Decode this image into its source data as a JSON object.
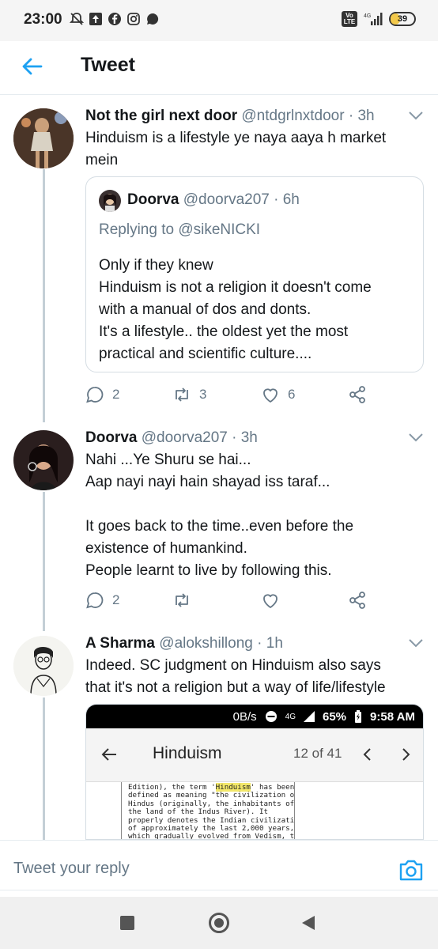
{
  "status_bar": {
    "time": "23:00",
    "network": "4G",
    "volte": "Vo LTE",
    "battery": "39",
    "battery_level_percent": 39
  },
  "header": {
    "title": "Tweet"
  },
  "tweets": [
    {
      "name": "Not the girl next door",
      "handle": "@ntdgrlnxtdoor",
      "time": "· 3h",
      "text": "Hinduism is a lifestyle ye naya aaya h market\nmein",
      "quote": {
        "name": "Doorva",
        "handle": "@doorva207",
        "time": "· 6h",
        "replying_to": "Replying to @sikeNICKI",
        "text": "Only if they knew\nHinduism is not a religion it doesn't come\nwith a manual of dos and donts.\nIt's a lifestyle.. the oldest yet the most\npractical and scientific culture...."
      },
      "reply_count": "2",
      "retweet_count": "3",
      "like_count": "6"
    },
    {
      "name": "Doorva",
      "handle": "@doorva207",
      "time": "· 3h",
      "text": "Nahi ...Ye Shuru se hai...\nAap nayi nayi hain shayad iss taraf...\n\nIt goes back to the time..even before the\nexistence of humankind.\nPeople learnt to live by following this.",
      "reply_count": "2",
      "retweet_count": "",
      "like_count": ""
    },
    {
      "name": "A Sharma",
      "handle": "@alokshillong",
      "time": "· 1h",
      "text": "Indeed. SC judgment on Hinduism also says\nthat it's not a religion but a way of life/lifestyle",
      "embed": {
        "data_rate": "0B/s",
        "network": "4G",
        "battery": "65%",
        "time": "9:58 AM",
        "title": "Hinduism",
        "page_count": "12 of 41",
        "doc_line_1_pre": "Edition), the term '",
        "doc_highlight": "Hinduism",
        "doc_line_1_post": "' has been",
        "doc_lines": "defined as meaning \"the civilization of\nHindus (originally, the inhabitants of\nthe land of the Indus River). It\nproperly denotes the Indian civilization\nof approximately the last 2,000 years,\nwhich gradually evolved from Vedism, the\nreligion of the ancient Indo-European"
      }
    }
  ],
  "reply_bar": {
    "placeholder": "Tweet your reply"
  },
  "icons": {
    "back": "arrow-left-icon",
    "caret": "chevron-down-icon",
    "reply": "reply-icon",
    "retweet": "retweet-icon",
    "like": "heart-icon",
    "share": "share-icon",
    "camera": "camera-icon"
  },
  "colors": {
    "accent": "#1da1f2",
    "secondary_text": "#657786",
    "thread_line": "#c4cfd6",
    "highlight": "#f3e86a"
  }
}
